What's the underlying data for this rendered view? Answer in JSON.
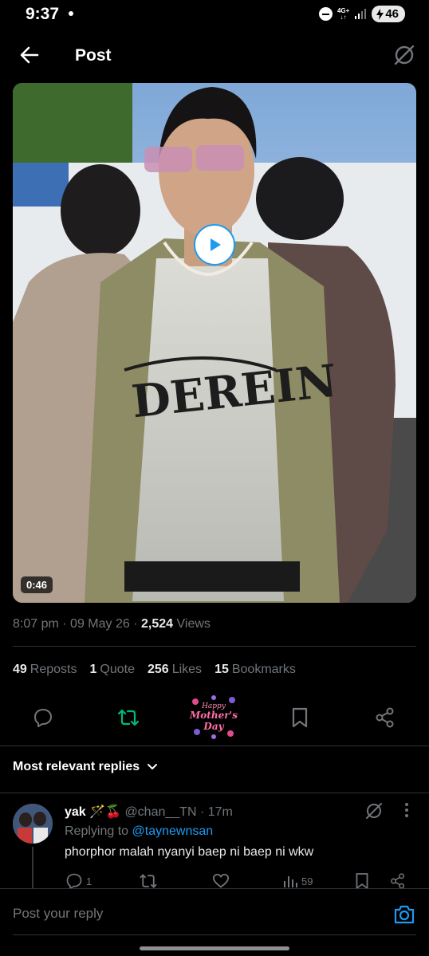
{
  "status_bar": {
    "time": "9:37",
    "network_top": "4G+",
    "network_bottom": "↓↑",
    "battery": "46"
  },
  "header": {
    "title": "Post"
  },
  "post": {
    "video_duration": "0:46",
    "time": "8:07 pm",
    "date": "09 May 26",
    "views_count": "2,524",
    "views_label": "Views",
    "separator": "·",
    "stats": [
      {
        "count": "49",
        "label": "Reposts"
      },
      {
        "count": "1",
        "label": "Quote"
      },
      {
        "count": "256",
        "label": "Likes"
      },
      {
        "count": "15",
        "label": "Bookmarks"
      }
    ],
    "mothers_day_badge": {
      "line1": "Happy",
      "line2": "Mother's",
      "line3": "Day"
    }
  },
  "replies_sort": {
    "label": "Most relevant replies"
  },
  "reply": {
    "name": "yak 🪄🍒",
    "handle": "@chan__TN",
    "age": "17m",
    "replying_to_label": "Replying to",
    "replying_to_handle": "@taynewnsan",
    "text": "phorphor malah nyanyi baep ni baep ni wkw",
    "reply_count": "1",
    "views_count": "59"
  },
  "composer": {
    "placeholder": "Post your reply"
  },
  "colors": {
    "accent": "#1d9bf0",
    "repost_active": "#00ba7c",
    "text_secondary": "#71767b"
  }
}
